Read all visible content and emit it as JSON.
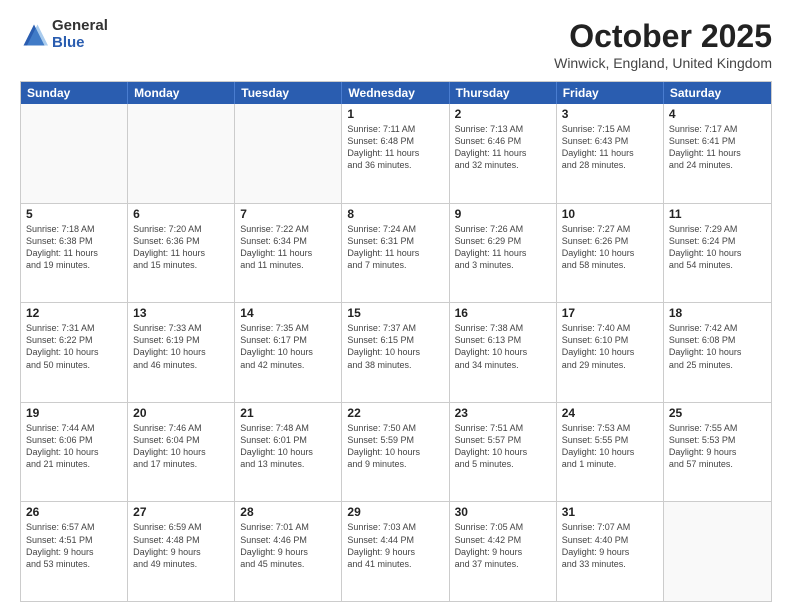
{
  "logo": {
    "general": "General",
    "blue": "Blue"
  },
  "title": {
    "month": "October 2025",
    "location": "Winwick, England, United Kingdom"
  },
  "header_days": [
    "Sunday",
    "Monday",
    "Tuesday",
    "Wednesday",
    "Thursday",
    "Friday",
    "Saturday"
  ],
  "rows": [
    [
      {
        "day": "",
        "info": "",
        "empty": true
      },
      {
        "day": "",
        "info": "",
        "empty": true
      },
      {
        "day": "",
        "info": "",
        "empty": true
      },
      {
        "day": "1",
        "info": "Sunrise: 7:11 AM\nSunset: 6:48 PM\nDaylight: 11 hours\nand 36 minutes."
      },
      {
        "day": "2",
        "info": "Sunrise: 7:13 AM\nSunset: 6:46 PM\nDaylight: 11 hours\nand 32 minutes."
      },
      {
        "day": "3",
        "info": "Sunrise: 7:15 AM\nSunset: 6:43 PM\nDaylight: 11 hours\nand 28 minutes."
      },
      {
        "day": "4",
        "info": "Sunrise: 7:17 AM\nSunset: 6:41 PM\nDaylight: 11 hours\nand 24 minutes."
      }
    ],
    [
      {
        "day": "5",
        "info": "Sunrise: 7:18 AM\nSunset: 6:38 PM\nDaylight: 11 hours\nand 19 minutes."
      },
      {
        "day": "6",
        "info": "Sunrise: 7:20 AM\nSunset: 6:36 PM\nDaylight: 11 hours\nand 15 minutes."
      },
      {
        "day": "7",
        "info": "Sunrise: 7:22 AM\nSunset: 6:34 PM\nDaylight: 11 hours\nand 11 minutes."
      },
      {
        "day": "8",
        "info": "Sunrise: 7:24 AM\nSunset: 6:31 PM\nDaylight: 11 hours\nand 7 minutes."
      },
      {
        "day": "9",
        "info": "Sunrise: 7:26 AM\nSunset: 6:29 PM\nDaylight: 11 hours\nand 3 minutes."
      },
      {
        "day": "10",
        "info": "Sunrise: 7:27 AM\nSunset: 6:26 PM\nDaylight: 10 hours\nand 58 minutes."
      },
      {
        "day": "11",
        "info": "Sunrise: 7:29 AM\nSunset: 6:24 PM\nDaylight: 10 hours\nand 54 minutes."
      }
    ],
    [
      {
        "day": "12",
        "info": "Sunrise: 7:31 AM\nSunset: 6:22 PM\nDaylight: 10 hours\nand 50 minutes."
      },
      {
        "day": "13",
        "info": "Sunrise: 7:33 AM\nSunset: 6:19 PM\nDaylight: 10 hours\nand 46 minutes."
      },
      {
        "day": "14",
        "info": "Sunrise: 7:35 AM\nSunset: 6:17 PM\nDaylight: 10 hours\nand 42 minutes."
      },
      {
        "day": "15",
        "info": "Sunrise: 7:37 AM\nSunset: 6:15 PM\nDaylight: 10 hours\nand 38 minutes."
      },
      {
        "day": "16",
        "info": "Sunrise: 7:38 AM\nSunset: 6:13 PM\nDaylight: 10 hours\nand 34 minutes."
      },
      {
        "day": "17",
        "info": "Sunrise: 7:40 AM\nSunset: 6:10 PM\nDaylight: 10 hours\nand 29 minutes."
      },
      {
        "day": "18",
        "info": "Sunrise: 7:42 AM\nSunset: 6:08 PM\nDaylight: 10 hours\nand 25 minutes."
      }
    ],
    [
      {
        "day": "19",
        "info": "Sunrise: 7:44 AM\nSunset: 6:06 PM\nDaylight: 10 hours\nand 21 minutes."
      },
      {
        "day": "20",
        "info": "Sunrise: 7:46 AM\nSunset: 6:04 PM\nDaylight: 10 hours\nand 17 minutes."
      },
      {
        "day": "21",
        "info": "Sunrise: 7:48 AM\nSunset: 6:01 PM\nDaylight: 10 hours\nand 13 minutes."
      },
      {
        "day": "22",
        "info": "Sunrise: 7:50 AM\nSunset: 5:59 PM\nDaylight: 10 hours\nand 9 minutes."
      },
      {
        "day": "23",
        "info": "Sunrise: 7:51 AM\nSunset: 5:57 PM\nDaylight: 10 hours\nand 5 minutes."
      },
      {
        "day": "24",
        "info": "Sunrise: 7:53 AM\nSunset: 5:55 PM\nDaylight: 10 hours\nand 1 minute."
      },
      {
        "day": "25",
        "info": "Sunrise: 7:55 AM\nSunset: 5:53 PM\nDaylight: 9 hours\nand 57 minutes."
      }
    ],
    [
      {
        "day": "26",
        "info": "Sunrise: 6:57 AM\nSunset: 4:51 PM\nDaylight: 9 hours\nand 53 minutes."
      },
      {
        "day": "27",
        "info": "Sunrise: 6:59 AM\nSunset: 4:48 PM\nDaylight: 9 hours\nand 49 minutes."
      },
      {
        "day": "28",
        "info": "Sunrise: 7:01 AM\nSunset: 4:46 PM\nDaylight: 9 hours\nand 45 minutes."
      },
      {
        "day": "29",
        "info": "Sunrise: 7:03 AM\nSunset: 4:44 PM\nDaylight: 9 hours\nand 41 minutes."
      },
      {
        "day": "30",
        "info": "Sunrise: 7:05 AM\nSunset: 4:42 PM\nDaylight: 9 hours\nand 37 minutes."
      },
      {
        "day": "31",
        "info": "Sunrise: 7:07 AM\nSunset: 4:40 PM\nDaylight: 9 hours\nand 33 minutes."
      },
      {
        "day": "",
        "info": "",
        "empty": true
      }
    ]
  ]
}
